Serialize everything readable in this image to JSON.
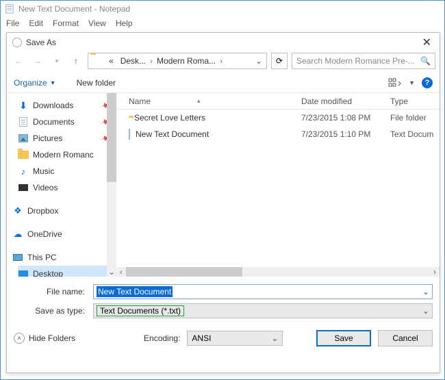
{
  "notepad": {
    "title": "New Text Document - Notepad",
    "menus": [
      "File",
      "Edit",
      "Format",
      "View",
      "Help"
    ]
  },
  "dialog": {
    "title": "Save As",
    "close": "✕",
    "breadcrumb": {
      "root": "«",
      "seg1": "Desk...",
      "seg2": "Modern Roma...",
      "chev": "›"
    },
    "search_placeholder": "Search Modern Romance Pre-...",
    "toolbar": {
      "organize": "Organize",
      "new_folder": "New folder"
    },
    "tree": [
      {
        "name": "Downloads",
        "icon": "download",
        "pinned": true
      },
      {
        "name": "Documents",
        "icon": "doc",
        "pinned": true
      },
      {
        "name": "Pictures",
        "icon": "pic",
        "pinned": true
      },
      {
        "name": "Modern Romance",
        "icon": "folder",
        "pinned": false,
        "truncated": "Modern Romanc"
      },
      {
        "name": "Music",
        "icon": "music",
        "pinned": false
      },
      {
        "name": "Videos",
        "icon": "video",
        "pinned": false
      },
      {
        "name": "Dropbox",
        "icon": "dropbox",
        "pinned": false,
        "gap": true
      },
      {
        "name": "OneDrive",
        "icon": "onedrive",
        "pinned": false,
        "gap": true
      },
      {
        "name": "This PC",
        "icon": "thispc",
        "pinned": false,
        "gap": true
      },
      {
        "name": "Desktop",
        "icon": "desktop",
        "pinned": false,
        "selected": true,
        "indent": true
      }
    ],
    "columns": {
      "name": "Name",
      "date": "Date modified",
      "type": "Type"
    },
    "files": [
      {
        "name": "Secret Love Letters",
        "icon": "folder",
        "date": "7/23/2015 1:08 PM",
        "type": "File folder"
      },
      {
        "name": "New Text Document",
        "icon": "doc",
        "date": "7/23/2015 1:10 PM",
        "type": "Text Docum"
      }
    ],
    "file_name_label": "File name:",
    "file_name_value": "New Text Document",
    "save_type_label": "Save as type:",
    "save_type_value": "Text Documents (*.txt)",
    "hide_folders": "Hide Folders",
    "encoding_label": "Encoding:",
    "encoding_value": "ANSI",
    "save_btn": "Save",
    "cancel_btn": "Cancel"
  }
}
